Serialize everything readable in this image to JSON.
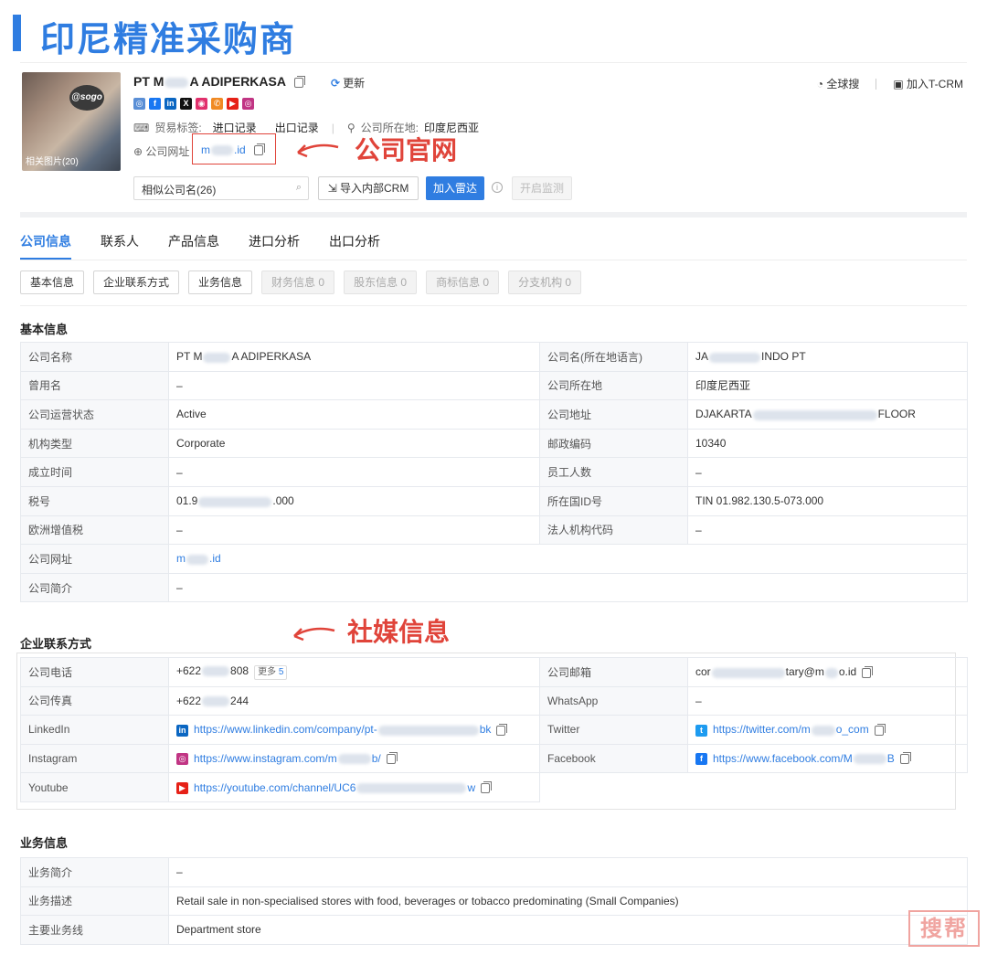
{
  "page_title": "印尼精准采购商",
  "company": {
    "name_prefix": "PT M",
    "name_suffix": "A ADIPERKASA",
    "refresh": "更新",
    "photo_caption": "相关图片(20)",
    "photo_sign": "@sogo",
    "trade_tag_label": "贸易标签:",
    "trade_tags": [
      "进口记录",
      "出口记录"
    ],
    "location_label": "公司所在地:",
    "location": "印度尼西亚",
    "website_label": "公司网址",
    "website_a": "m",
    "website_b": ".id",
    "global_search": "全球搜",
    "add_tcrm": "加入T-CRM",
    "similar": "相似公司名(26)",
    "import_crm": "导入内部CRM",
    "add_radar": "加入雷达",
    "monitor": "开启监测"
  },
  "annotations": {
    "website": "公司官网",
    "social": "社媒信息"
  },
  "socials": [
    {
      "name": "site",
      "color": "#5a8fd6",
      "glyph": "◎"
    },
    {
      "name": "facebook",
      "color": "#1877f2",
      "glyph": "f"
    },
    {
      "name": "linkedin",
      "color": "#0a66c2",
      "glyph": "in"
    },
    {
      "name": "x",
      "color": "#111111",
      "glyph": "X"
    },
    {
      "name": "instagram-alt",
      "color": "#e1306c",
      "glyph": "◉"
    },
    {
      "name": "phone",
      "color": "#f08a24",
      "glyph": "✆"
    },
    {
      "name": "youtube",
      "color": "#e62117",
      "glyph": "▶"
    },
    {
      "name": "instagram",
      "color": "#c13584",
      "glyph": "◎"
    }
  ],
  "tabs": [
    "公司信息",
    "联系人",
    "产品信息",
    "进口分析",
    "出口分析"
  ],
  "subtabs": [
    {
      "label": "基本信息",
      "disabled": false
    },
    {
      "label": "企业联系方式",
      "disabled": false
    },
    {
      "label": "业务信息",
      "disabled": false
    },
    {
      "label": "财务信息 0",
      "disabled": true
    },
    {
      "label": "股东信息 0",
      "disabled": true
    },
    {
      "label": "商标信息 0",
      "disabled": true
    },
    {
      "label": "分支机构 0",
      "disabled": true
    }
  ],
  "basic": {
    "title": "基本信息",
    "rows": [
      [
        "公司名称",
        "PT M|A ADIPERKASA",
        "公司名(所在地语言)",
        "JA|INDO PT"
      ],
      [
        "曾用名",
        "–",
        "公司所在地",
        "印度尼西亚"
      ],
      [
        "公司运营状态",
        "Active",
        "公司地址",
        "DJAKARTA|FLOOR"
      ],
      [
        "机构类型",
        "Corporate",
        "邮政编码",
        "10340"
      ],
      [
        "成立时间",
        "–",
        "员工人数",
        "–"
      ],
      [
        "税号",
        "01.9|.000",
        "所在国ID号",
        "TIN 01.982.130.5-073.000"
      ],
      [
        "欧洲增值税",
        "–",
        "法人机构代码",
        "–"
      ],
      [
        "公司网址",
        "m|.id"
      ],
      [
        "公司简介",
        "–"
      ]
    ]
  },
  "contact": {
    "title": "企业联系方式",
    "phone_label": "公司电话",
    "phone_a": "+622",
    "phone_b": "808",
    "more_label": "更多",
    "more_count": "5",
    "email_label": "公司邮箱",
    "email_a": "cor",
    "email_b": "tary@m",
    "email_c": "o.id",
    "fax_label": "公司传真",
    "fax_a": "+622",
    "fax_b": "244",
    "whatsapp_label": "WhatsApp",
    "whatsapp": "–",
    "linkedin_label": "LinkedIn",
    "linkedin_a": "https://www.linkedin.com/company/pt-",
    "linkedin_b": "bk",
    "twitter_label": "Twitter",
    "twitter_a": "https://twitter.com/m",
    "twitter_b": "o_com",
    "instagram_label": "Instagram",
    "instagram_a": "https://www.instagram.com/m",
    "instagram_b": "b/",
    "facebook_label": "Facebook",
    "facebook_a": "https://www.facebook.com/M",
    "facebook_b": "B",
    "youtube_label": "Youtube",
    "youtube_a": "https://youtube.com/channel/UC6",
    "youtube_b": "w"
  },
  "business": {
    "title": "业务信息",
    "rows": [
      [
        "业务简介",
        "–"
      ],
      [
        "业务描述",
        "Retail sale in non-specialised stores with food, beverages or tobacco predominating (Small Companies)"
      ],
      [
        "主要业务线",
        "Department store"
      ]
    ]
  },
  "watermark": "搜帮"
}
